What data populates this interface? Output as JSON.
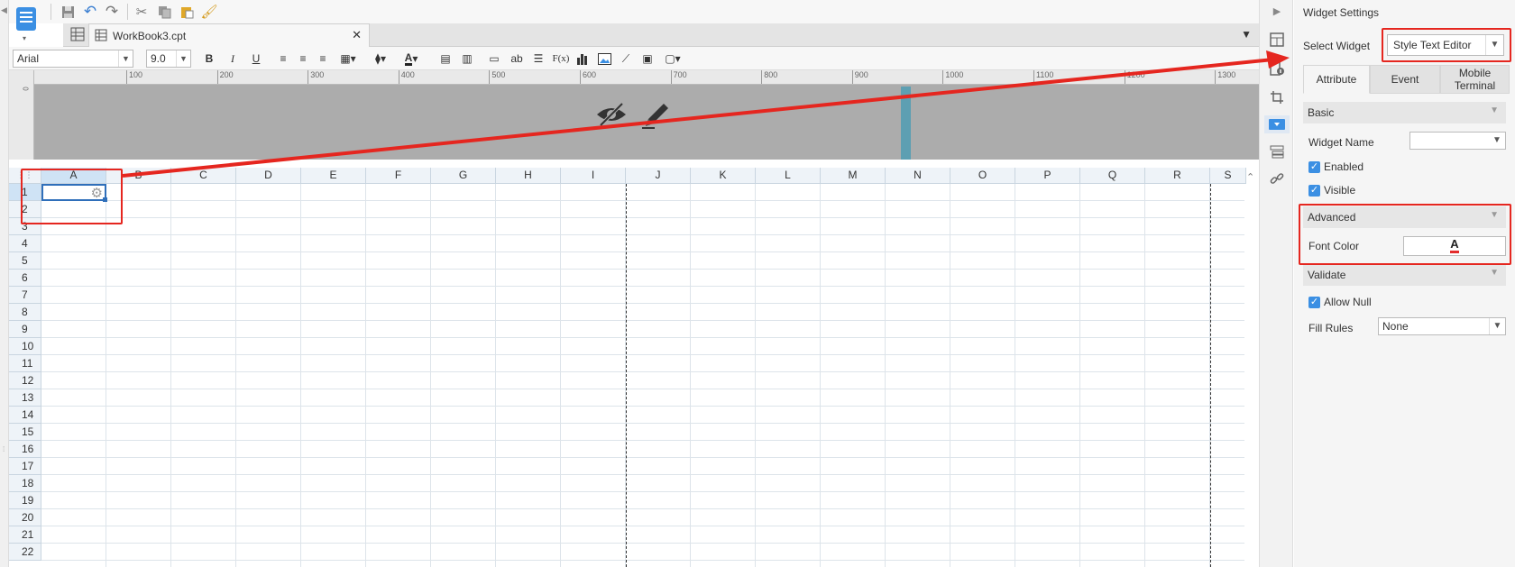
{
  "file_tab": {
    "name": "WorkBook3.cpt",
    "close": "✕"
  },
  "format": {
    "font_family": "Arial",
    "font_size": "9.0",
    "bold": "B",
    "italic": "I",
    "underline": "U",
    "text_ab": "ab",
    "formula": "F(x)"
  },
  "ruler": {
    "zero": "0",
    "ticks": [
      "100",
      "200",
      "300",
      "400",
      "500",
      "600",
      "700",
      "800",
      "900",
      "1000",
      "1100",
      "1200",
      "1300"
    ]
  },
  "grid": {
    "columns": [
      "A",
      "B",
      "C",
      "D",
      "E",
      "F",
      "G",
      "H",
      "I",
      "J",
      "K",
      "L",
      "M",
      "N",
      "O",
      "P",
      "Q",
      "R",
      "S"
    ],
    "rows": [
      "1",
      "2",
      "3",
      "4",
      "5",
      "6",
      "7",
      "8",
      "9",
      "10",
      "11",
      "12",
      "13",
      "14",
      "15",
      "16",
      "17",
      "18",
      "19",
      "20",
      "21",
      "22"
    ]
  },
  "panel": {
    "title": "Widget Settings",
    "select_widget_label": "Select Widget",
    "select_widget_value": "Style Text Editor",
    "tabs": [
      "Attribute",
      "Event",
      "Mobile Terminal"
    ],
    "sections": {
      "basic": "Basic",
      "advanced": "Advanced",
      "validate": "Validate"
    },
    "widget_name_label": "Widget Name",
    "enabled_label": "Enabled",
    "visible_label": "Visible",
    "font_color_label": "Font Color",
    "font_color_glyph": "A",
    "allow_null_label": "Allow Null",
    "fill_rules_label": "Fill Rules",
    "fill_rules_value": "None"
  },
  "colors": {
    "accent": "#3b8fe3",
    "annotation": "#e5261f",
    "selection": "#2f6fba"
  }
}
